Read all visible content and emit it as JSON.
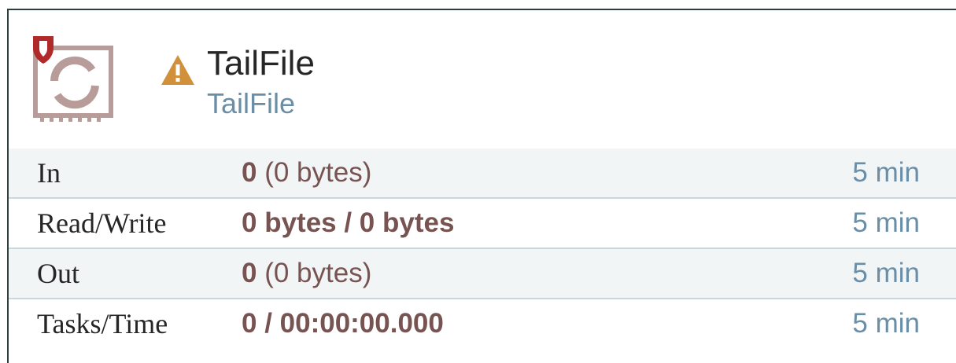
{
  "processor": {
    "name": "TailFile",
    "type": "TailFile",
    "icons": {
      "processor": "processor-icon",
      "restricted": "shield-icon",
      "status": "warning-icon"
    },
    "colors": {
      "warning": "#d1903a",
      "restricted_badge": "#b02a2a",
      "stat_value": "#775351",
      "stat_window": "#6a8ea6",
      "row_shade": "#f2f5f6"
    }
  },
  "stats": [
    {
      "label": "In",
      "count": "0",
      "detail": " (0 bytes)",
      "window": "5 min"
    },
    {
      "label": "Read/Write",
      "value": "0 bytes / 0 bytes",
      "window": "5 min"
    },
    {
      "label": "Out",
      "count": "0",
      "detail": " (0 bytes)",
      "window": "5 min"
    },
    {
      "label": "Tasks/Time",
      "value": "0 / 00:00:00.000",
      "window": "5 min"
    }
  ]
}
